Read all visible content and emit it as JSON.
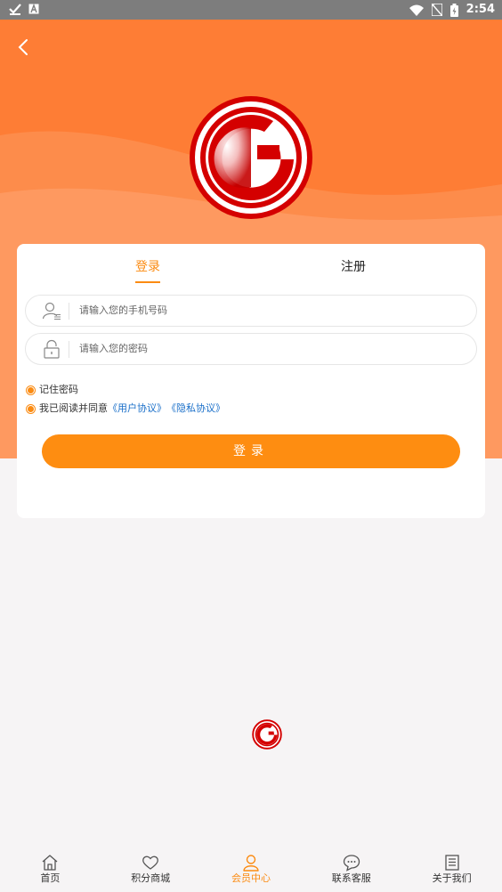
{
  "status_bar": {
    "time": "2:54"
  },
  "login_tabs": [
    {
      "label": "登录",
      "active": true
    },
    {
      "label": "注册",
      "active": false
    }
  ],
  "form": {
    "phone_placeholder": "请输入您的手机号码",
    "password_placeholder": "请输入您的密码",
    "remember_label": "记住密码",
    "agree_prefix": "我已阅读并同意",
    "user_agreement_link": "《用户协议》",
    "privacy_link": "《隐私协议》",
    "login_button": "登录"
  },
  "tabbar": [
    {
      "label": "首页",
      "icon": "home-icon",
      "active": false
    },
    {
      "label": "积分商城",
      "icon": "heart-icon",
      "active": false
    },
    {
      "label": "会员中心",
      "icon": "user-icon",
      "active": true
    },
    {
      "label": "联系客服",
      "icon": "chat-icon",
      "active": false
    },
    {
      "label": "关于我们",
      "icon": "document-icon",
      "active": false
    }
  ],
  "colors": {
    "primary": "#fe8d11",
    "hero": "#fe7d35",
    "link": "#1a6fc9",
    "logo_red": "#d40000"
  }
}
